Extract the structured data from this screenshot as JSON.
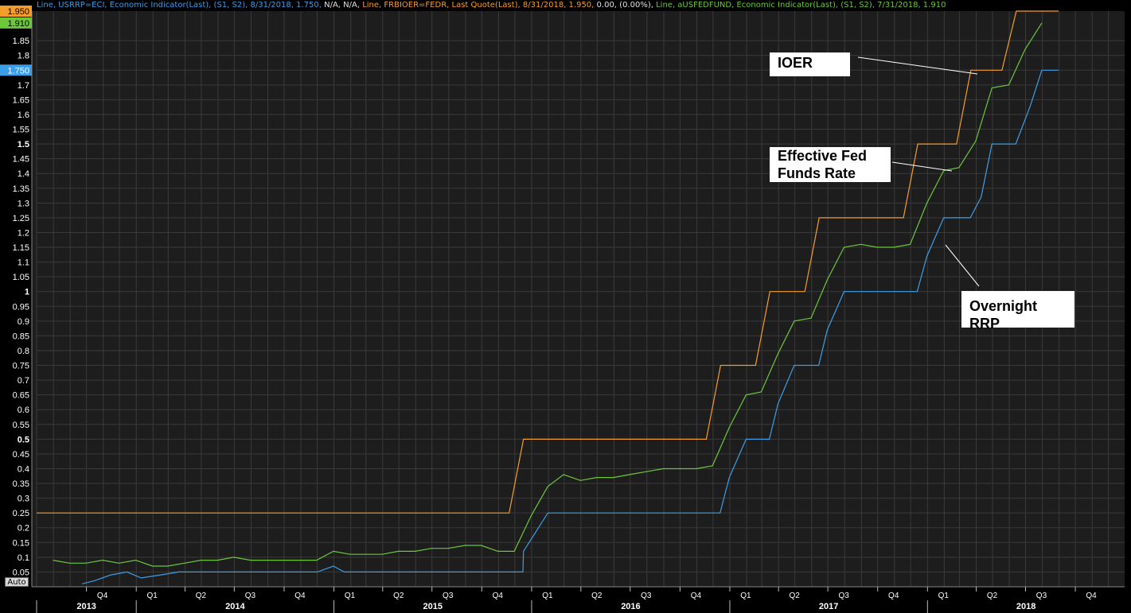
{
  "legend": [
    {
      "text": "Line, USRRP=ECI, Economic Indicator(Last), (S1, S2), 8/31/2018, 1.750,",
      "color": "#3c9ee8"
    },
    {
      "text": " N/A, N/A,",
      "color": "#e0e0e0"
    },
    {
      "text": " Line, FRBIOER=FEDR, Last Quote(Last), 8/31/2018, 1.950,",
      "color": "#f59d2a"
    },
    {
      "text": " 0.00, (0.00%),",
      "color": "#e0e0e0"
    },
    {
      "text": " Line, aUSFEDFUND, Economic Indicator(Last), (S1, S2), 7/31/2018, 1.910",
      "color": "#6cc83a"
    }
  ],
  "annotations": {
    "ioer": "IOER",
    "effr": "Effective Fed Funds Rate",
    "rrp": "Overnight RRP"
  },
  "controls": {
    "auto_label": "Auto"
  },
  "colors": {
    "background": "#1d1d1d",
    "grid": "#3a3a3a",
    "ioer": "#f59d2a",
    "effr": "#6cc83a",
    "rrp": "#3c9ee8",
    "axis_text": "#ffffff"
  },
  "chart_data": {
    "type": "line",
    "title": "",
    "xlabel": "",
    "ylabel": "",
    "x_range": [
      "2013-07-01",
      "2018-12-31"
    ],
    "ylim": [
      0,
      1.95
    ],
    "y_ticks": [
      0.05,
      0.1,
      0.15,
      0.2,
      0.25,
      0.3,
      0.35,
      0.4,
      0.45,
      0.5,
      0.55,
      0.6,
      0.65,
      0.7,
      0.75,
      0.8,
      0.85,
      0.9,
      0.95,
      1,
      1.05,
      1.1,
      1.15,
      1.2,
      1.25,
      1.3,
      1.35,
      1.4,
      1.45,
      1.5,
      1.55,
      1.6,
      1.65,
      1.7,
      1.75,
      1.8,
      1.85
    ],
    "y_tick_labels": [
      "0.05",
      "0.1",
      "0.15",
      "0.2",
      "0.25",
      "0.3",
      "0.35",
      "0.4",
      "0.45",
      "0.5",
      "0.55",
      "0.6",
      "0.65",
      "0.7",
      "0.75",
      "0.8",
      "0.85",
      "0.9",
      "0.95",
      "1",
      "1.05",
      "1.1",
      "1.15",
      "1.2",
      "1.25",
      "1.3",
      "1.35",
      "1.4",
      "1.45",
      "1.5",
      "1.55",
      "1.6",
      "1.65",
      "1.7",
      "1.75",
      "1.8",
      "1.85"
    ],
    "y_bold_ticks": [
      "0.5",
      "1",
      "1.5"
    ],
    "quarter_labels": [
      {
        "date": "2013-10-01",
        "label": "Q4"
      },
      {
        "date": "2014-01-01",
        "label": "Q1"
      },
      {
        "date": "2014-04-01",
        "label": "Q2"
      },
      {
        "date": "2014-07-01",
        "label": "Q3"
      },
      {
        "date": "2014-10-01",
        "label": "Q4"
      },
      {
        "date": "2015-01-01",
        "label": "Q1"
      },
      {
        "date": "2015-04-01",
        "label": "Q2"
      },
      {
        "date": "2015-07-01",
        "label": "Q3"
      },
      {
        "date": "2015-10-01",
        "label": "Q4"
      },
      {
        "date": "2016-01-01",
        "label": "Q1"
      },
      {
        "date": "2016-04-01",
        "label": "Q2"
      },
      {
        "date": "2016-07-01",
        "label": "Q3"
      },
      {
        "date": "2016-10-01",
        "label": "Q4"
      },
      {
        "date": "2017-01-01",
        "label": "Q1"
      },
      {
        "date": "2017-04-01",
        "label": "Q2"
      },
      {
        "date": "2017-07-01",
        "label": "Q3"
      },
      {
        "date": "2017-10-01",
        "label": "Q4"
      },
      {
        "date": "2018-01-01",
        "label": "Q1"
      },
      {
        "date": "2018-04-01",
        "label": "Q2"
      },
      {
        "date": "2018-07-01",
        "label": "Q3"
      },
      {
        "date": "2018-10-01",
        "label": "Q4"
      }
    ],
    "year_labels": [
      {
        "label": "2013",
        "start": "2013-07-01",
        "end": "2014-01-01"
      },
      {
        "label": "2014",
        "start": "2014-01-01",
        "end": "2015-01-01"
      },
      {
        "label": "2015",
        "start": "2015-01-01",
        "end": "2016-01-01"
      },
      {
        "label": "2016",
        "start": "2016-01-01",
        "end": "2017-01-01"
      },
      {
        "label": "2017",
        "start": "2017-01-01",
        "end": "2018-01-01"
      },
      {
        "label": "2018",
        "start": "2018-01-01",
        "end": "2018-12-31"
      }
    ],
    "last_value_tags": [
      {
        "label": "1.950",
        "value": 1.95,
        "series": "IOER"
      },
      {
        "label": "1.910",
        "value": 1.91,
        "series": "Effective Fed Funds Rate"
      },
      {
        "label": "1.750",
        "value": 1.75,
        "series": "Overnight RRP"
      }
    ],
    "series": [
      {
        "name": "IOER",
        "step": true,
        "points": [
          [
            "2013-07-01",
            0.25
          ],
          [
            "2015-12-17",
            0.5
          ],
          [
            "2016-12-15",
            0.75
          ],
          [
            "2017-03-16",
            1.0
          ],
          [
            "2017-06-15",
            1.25
          ],
          [
            "2017-12-14",
            1.5
          ],
          [
            "2018-03-22",
            1.75
          ],
          [
            "2018-06-14",
            1.95
          ],
          [
            "2018-08-31",
            1.95
          ]
        ]
      },
      {
        "name": "Effective Fed Funds Rate",
        "step": false,
        "points": [
          [
            "2013-07-31",
            0.09
          ],
          [
            "2013-08-31",
            0.08
          ],
          [
            "2013-09-30",
            0.08
          ],
          [
            "2013-10-31",
            0.09
          ],
          [
            "2013-11-30",
            0.08
          ],
          [
            "2013-12-31",
            0.09
          ],
          [
            "2014-01-31",
            0.07
          ],
          [
            "2014-02-28",
            0.07
          ],
          [
            "2014-03-31",
            0.08
          ],
          [
            "2014-04-30",
            0.09
          ],
          [
            "2014-05-31",
            0.09
          ],
          [
            "2014-06-30",
            0.1
          ],
          [
            "2014-07-31",
            0.09
          ],
          [
            "2014-08-31",
            0.09
          ],
          [
            "2014-09-30",
            0.09
          ],
          [
            "2014-10-31",
            0.09
          ],
          [
            "2014-11-30",
            0.09
          ],
          [
            "2014-12-31",
            0.12
          ],
          [
            "2015-01-31",
            0.11
          ],
          [
            "2015-02-28",
            0.11
          ],
          [
            "2015-03-31",
            0.11
          ],
          [
            "2015-04-30",
            0.12
          ],
          [
            "2015-05-31",
            0.12
          ],
          [
            "2015-06-30",
            0.13
          ],
          [
            "2015-07-31",
            0.13
          ],
          [
            "2015-08-31",
            0.14
          ],
          [
            "2015-09-30",
            0.14
          ],
          [
            "2015-10-31",
            0.12
          ],
          [
            "2015-11-30",
            0.12
          ],
          [
            "2015-12-31",
            0.24
          ],
          [
            "2016-01-31",
            0.34
          ],
          [
            "2016-02-29",
            0.38
          ],
          [
            "2016-03-31",
            0.36
          ],
          [
            "2016-04-30",
            0.37
          ],
          [
            "2016-05-31",
            0.37
          ],
          [
            "2016-06-30",
            0.38
          ],
          [
            "2016-07-31",
            0.39
          ],
          [
            "2016-08-31",
            0.4
          ],
          [
            "2016-09-30",
            0.4
          ],
          [
            "2016-10-31",
            0.4
          ],
          [
            "2016-11-30",
            0.41
          ],
          [
            "2016-12-31",
            0.54
          ],
          [
            "2017-01-31",
            0.65
          ],
          [
            "2017-02-28",
            0.66
          ],
          [
            "2017-03-31",
            0.79
          ],
          [
            "2017-04-30",
            0.9
          ],
          [
            "2017-05-31",
            0.91
          ],
          [
            "2017-06-30",
            1.04
          ],
          [
            "2017-07-31",
            1.15
          ],
          [
            "2017-08-31",
            1.16
          ],
          [
            "2017-09-30",
            1.15
          ],
          [
            "2017-10-31",
            1.15
          ],
          [
            "2017-11-30",
            1.16
          ],
          [
            "2017-12-31",
            1.3
          ],
          [
            "2018-01-31",
            1.41
          ],
          [
            "2018-02-28",
            1.42
          ],
          [
            "2018-03-31",
            1.51
          ],
          [
            "2018-04-30",
            1.69
          ],
          [
            "2018-05-31",
            1.7
          ],
          [
            "2018-06-30",
            1.82
          ],
          [
            "2018-07-31",
            1.91
          ]
        ]
      },
      {
        "name": "Overnight RRP",
        "step": false,
        "points": [
          [
            "2013-09-23",
            0.01
          ],
          [
            "2013-10-15",
            0.02
          ],
          [
            "2013-11-15",
            0.04
          ],
          [
            "2013-12-15",
            0.05
          ],
          [
            "2014-01-10",
            0.03
          ],
          [
            "2014-02-15",
            0.04
          ],
          [
            "2014-03-20",
            0.05
          ],
          [
            "2014-12-01",
            0.05
          ],
          [
            "2014-12-31",
            0.07
          ],
          [
            "2015-01-20",
            0.05
          ],
          [
            "2015-12-16",
            0.05
          ],
          [
            "2015-12-17",
            0.12
          ],
          [
            "2016-01-31",
            0.25
          ],
          [
            "2016-12-14",
            0.25
          ],
          [
            "2016-12-31",
            0.37
          ],
          [
            "2017-01-31",
            0.5
          ],
          [
            "2017-03-15",
            0.5
          ],
          [
            "2017-03-31",
            0.62
          ],
          [
            "2017-04-30",
            0.75
          ],
          [
            "2017-06-14",
            0.75
          ],
          [
            "2017-06-30",
            0.87
          ],
          [
            "2017-07-31",
            1.0
          ],
          [
            "2017-12-13",
            1.0
          ],
          [
            "2017-12-31",
            1.12
          ],
          [
            "2018-01-31",
            1.25
          ],
          [
            "2018-03-21",
            1.25
          ],
          [
            "2018-04-10",
            1.32
          ],
          [
            "2018-04-30",
            1.5
          ],
          [
            "2018-06-13",
            1.5
          ],
          [
            "2018-07-10",
            1.63
          ],
          [
            "2018-07-31",
            1.75
          ],
          [
            "2018-08-31",
            1.75
          ]
        ]
      }
    ],
    "grid": true
  }
}
